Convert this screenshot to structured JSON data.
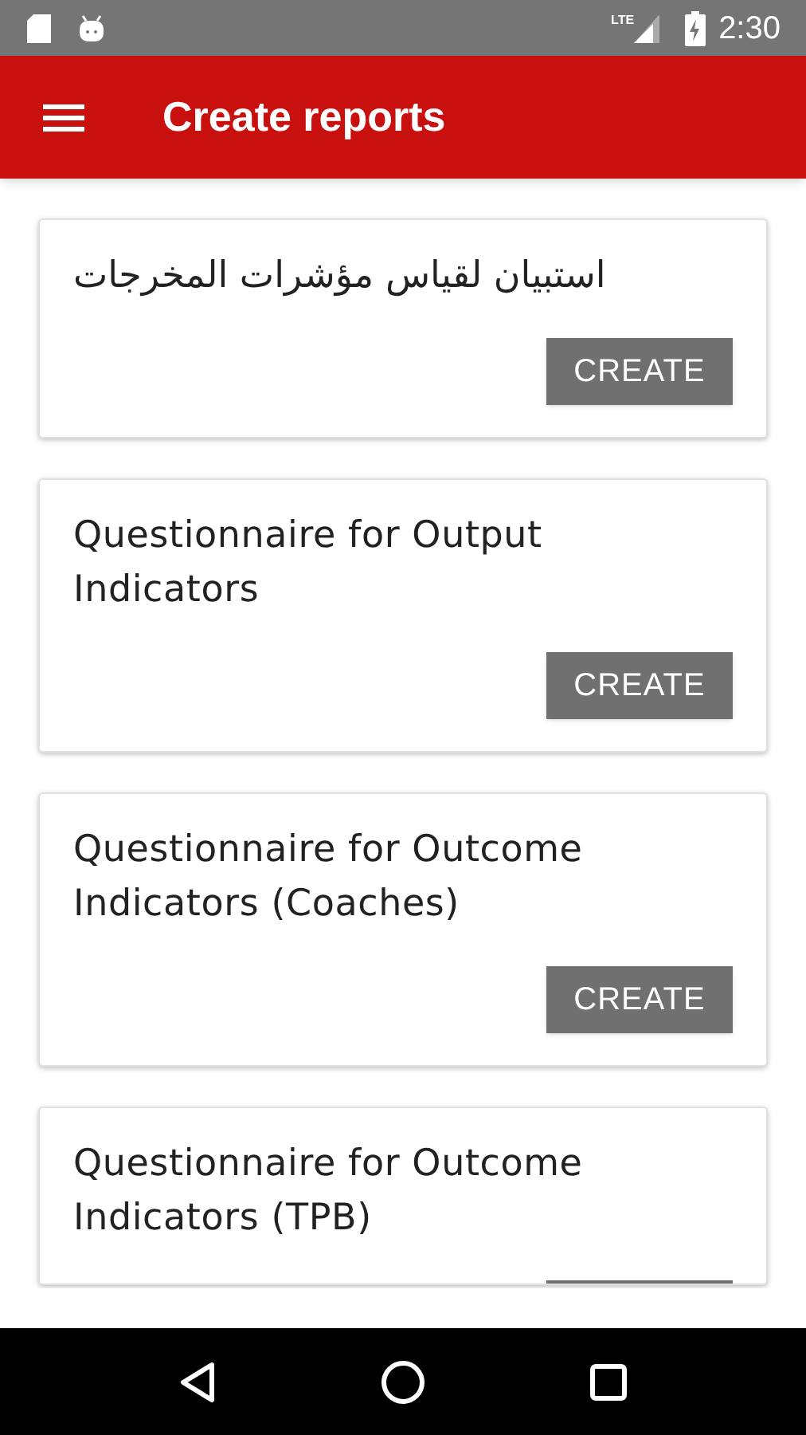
{
  "status_bar": {
    "time": "2:30",
    "network": "LTE"
  },
  "app_bar": {
    "title": "Create reports"
  },
  "reports": [
    {
      "kind": "full",
      "title": "استبيان لقياس مؤشرات المخرجات",
      "button": "CREATE"
    },
    {
      "kind": "full",
      "title": "Questionnaire for Output Indicators",
      "button": "CREATE"
    },
    {
      "kind": "full",
      "title": "Questionnaire for Outcome Indicators (Coaches)",
      "button": "CREATE"
    },
    {
      "kind": "cut",
      "title": "Questionnaire for Outcome Indicators (TPB)"
    }
  ]
}
